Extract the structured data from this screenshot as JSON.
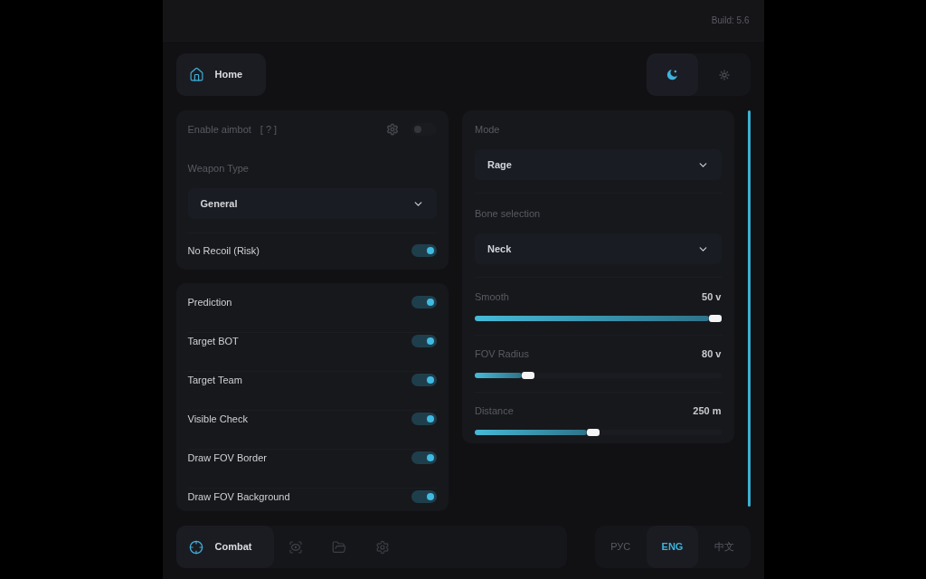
{
  "header": {
    "build": "Build: 5.6"
  },
  "home_button": {
    "label": "Home"
  },
  "theme_toggle": [
    {
      "kind": "moon",
      "selected": true
    },
    {
      "kind": "sun",
      "selected": false
    }
  ],
  "aimbot_card": {
    "enable": {
      "label": "Enable aimbot",
      "hint": "[ ? ]",
      "on": false
    },
    "weapon_type": {
      "label": "Weapon Type",
      "value": "General"
    },
    "no_recoil": {
      "label": "No Recoil (Risk)",
      "on": true
    }
  },
  "toggles": [
    {
      "label": "Prediction",
      "on": true
    },
    {
      "label": "Target BOT",
      "on": true
    },
    {
      "label": "Target Team",
      "on": true
    },
    {
      "label": "Visible Check",
      "on": true
    },
    {
      "label": "Draw FOV Border",
      "on": true
    },
    {
      "label": "Draw FOV Background",
      "on": true
    }
  ],
  "settings_card": {
    "dropdowns": [
      {
        "label": "Mode",
        "value": "Rage"
      },
      {
        "label": "Bone selection",
        "value": "Neck"
      }
    ],
    "sliders": [
      {
        "label": "Smooth",
        "reading": "50 v",
        "level": 1.0
      },
      {
        "label": "FOV Radius",
        "reading": "80 v",
        "level": 0.2
      },
      {
        "label": "Distance",
        "reading": "250 m",
        "level": 0.48
      }
    ]
  },
  "bottom_nav": [
    {
      "kind": "crosshair",
      "label": "Combat",
      "selected": true
    },
    {
      "kind": "scan-eye",
      "selected": false
    },
    {
      "kind": "folder",
      "selected": false
    },
    {
      "kind": "gear",
      "selected": false
    }
  ],
  "languages": [
    {
      "label": "РУС",
      "selected": false
    },
    {
      "label": "ENG",
      "selected": true
    },
    {
      "label": "中文",
      "selected": false
    }
  ]
}
